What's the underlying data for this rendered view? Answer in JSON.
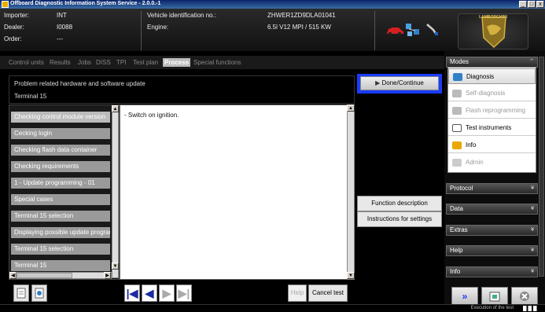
{
  "window": {
    "title": "Offboard Diagnostic Information System Service - 2.0.0.-1",
    "min": "_",
    "max": "□",
    "close": "x"
  },
  "header": {
    "importer_label": "Importer:",
    "importer_value": "INT",
    "dealer_label": "Dealer:",
    "dealer_value": "I0088",
    "order_label": "Order:",
    "order_value": "---",
    "vin_label": "Vehicle identification no.:",
    "vin_value": "ZHWER1ZD9DLA01041",
    "engine_label": "Engine:",
    "engine_value": "6.5l V12 MPI / 515 KW"
  },
  "tabs": [
    "Control units",
    "Results",
    "Jobs",
    "DISS",
    "TPI",
    "Test plan",
    "Process",
    "Special functions"
  ],
  "problem": {
    "line1": "Problem related hardware and software update",
    "line2": "Terminal 15"
  },
  "done_button": "Done/Continue",
  "steps": [
    "Checking control module version",
    "Cecking login",
    "Checking flash data container",
    "Checking requirements",
    "1 - Update programming - 01",
    "Special cases",
    "Terminal 15 selection",
    "Displaying possible update programming",
    "Terminal 15 selection",
    "Terminal 15"
  ],
  "content_text": "- Switch on ignition.",
  "function_buttons": {
    "description": "Function description",
    "instructions": "Instructions for settings"
  },
  "bottom": {
    "first": "|◀",
    "prev": "◀",
    "next": "▶",
    "last": "▶|",
    "help": "Help",
    "cancel": "Cancel test"
  },
  "right_panel": {
    "modes": "Modes",
    "mode_items": [
      {
        "label": "Diagnosis",
        "enabled": true
      },
      {
        "label": "Self-diagnosis",
        "enabled": false
      },
      {
        "label": "Flash reprogramming",
        "enabled": false
      },
      {
        "label": "Test instruments",
        "enabled": true
      },
      {
        "label": "Info",
        "enabled": true
      },
      {
        "label": "Admin",
        "enabled": false
      }
    ],
    "sections": [
      "Protocol",
      "Data",
      "Extras",
      "Help",
      "Info"
    ],
    "collapse_arrow": "»",
    "expand_arrow": "«"
  },
  "status": {
    "text": "Execution of the test"
  },
  "logo_text": "LAMBORGHINI",
  "colors": {
    "accent_blue": "#1a3cff",
    "nav_blue": "#1a2aa0"
  }
}
